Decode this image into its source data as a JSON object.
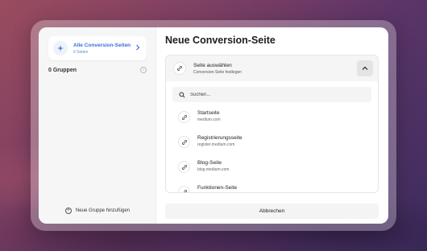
{
  "sidebar": {
    "all_pages": {
      "title": "Alle Conversion-Seiten",
      "subtitle": "0 Seiten",
      "icon": "sparkle-icon"
    },
    "groups_label": "0 Gruppen",
    "info_icon": "i",
    "add_group_label": "Neue Gruppe hinzufügen"
  },
  "main": {
    "title": "Neue Conversion-Seite",
    "select": {
      "title": "Seite auswählen",
      "subtitle": "Conversion-Seite festlegen"
    },
    "search": {
      "placeholder": "Suchen..."
    },
    "pages": [
      {
        "name": "Startseite",
        "url": "medium.com"
      },
      {
        "name": "Registrierungsseite",
        "url": "register.medium.com"
      },
      {
        "name": "Blog-Seite",
        "url": "blog.medium.com"
      },
      {
        "name": "Funktionen-Seite",
        "url": ""
      }
    ],
    "cancel_label": "Abbrechen"
  },
  "colors": {
    "accent": "#3a6fd8",
    "sidebar_bg": "#f6f6f7"
  }
}
